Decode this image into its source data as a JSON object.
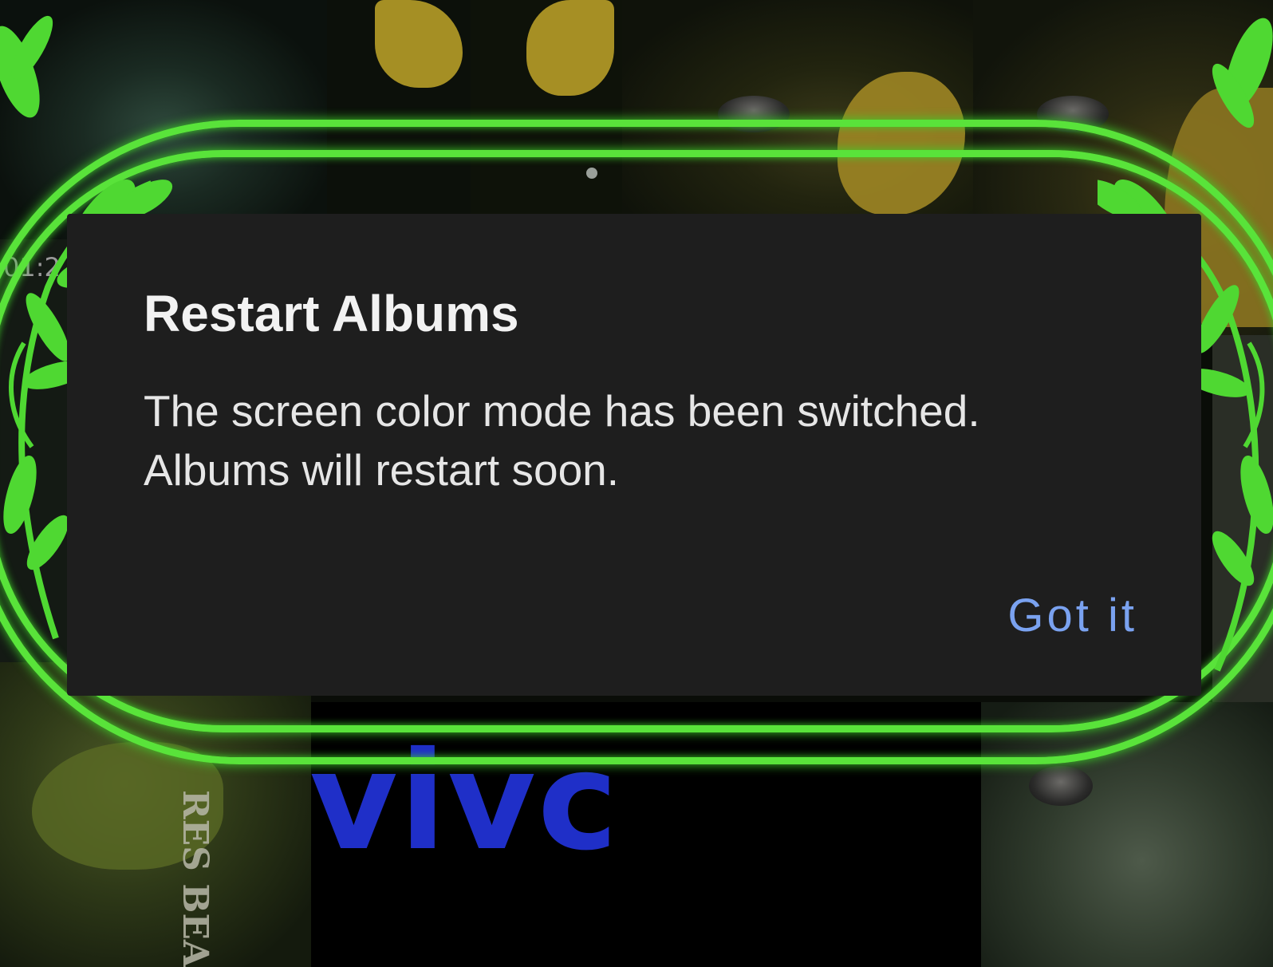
{
  "dialog": {
    "title": "Restart Albums",
    "message_line1": "The screen color mode has been switched.",
    "message_line2": "Albums will restart soon.",
    "confirm_label": "Got it"
  },
  "background": {
    "timestamp": "01:2",
    "side_text": "RES BEA",
    "brand_logo": "vivc"
  },
  "colors": {
    "dialog_bg": "#1e1e1e",
    "accent_button": "#7aa2f0",
    "frame_green": "#59e33a",
    "brand_blue": "#1f2fc8"
  },
  "icons": [
    "leaf-vine-decoration"
  ]
}
